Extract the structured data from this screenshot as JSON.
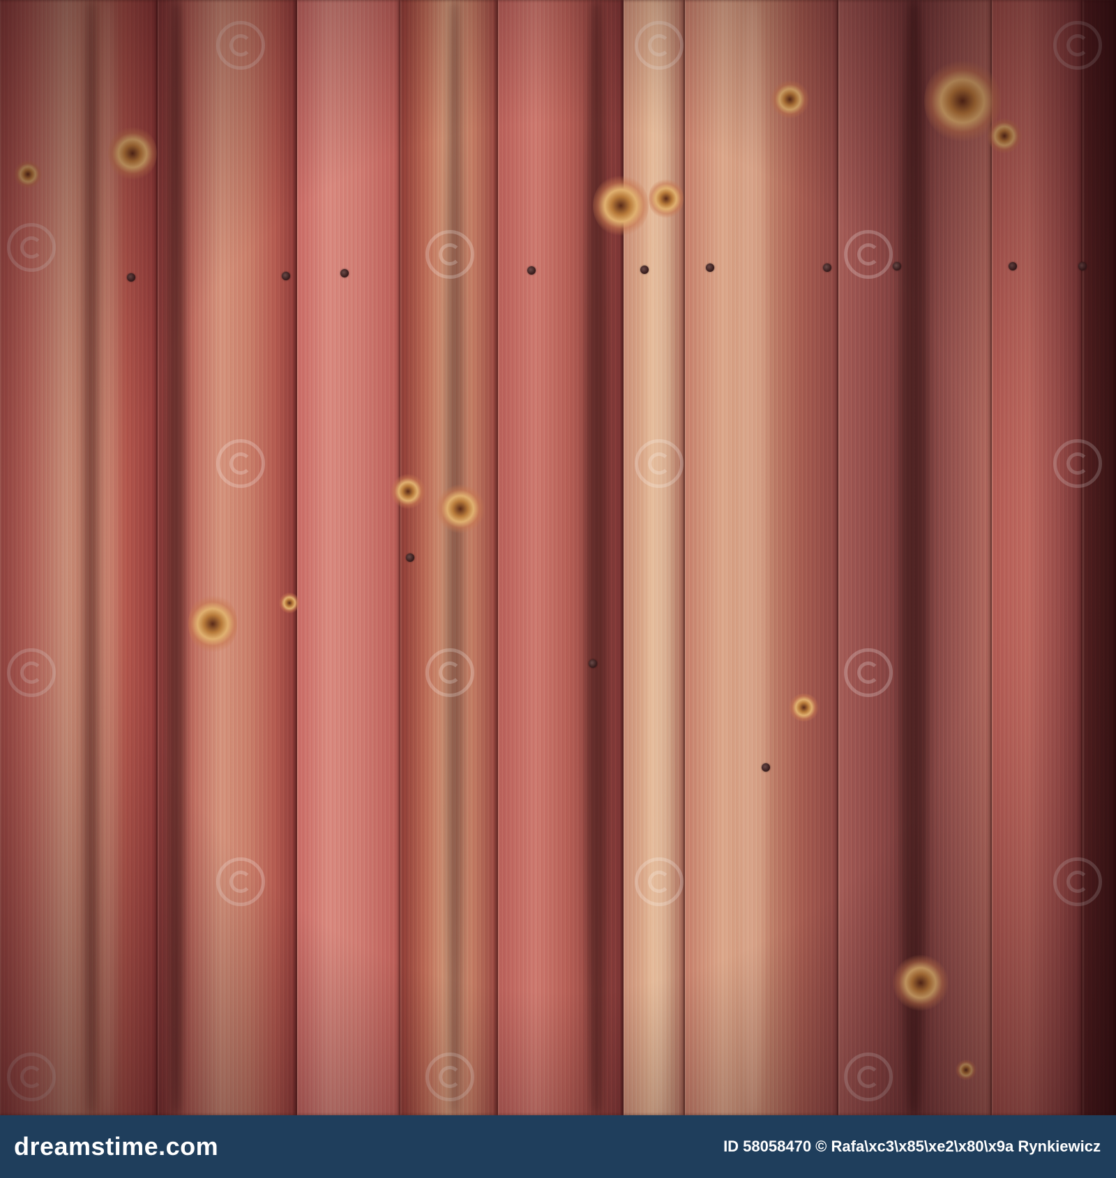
{
  "image": {
    "subject": "wood-planks",
    "palette": {
      "plank_base": "#b5574e",
      "plank_light": "#d9938a",
      "plank_dark": "#6b2a2a",
      "knot": "#d9a060",
      "footer_bg": "#1f3e5c"
    }
  },
  "footer": {
    "logo": "dreamstime.com",
    "credit": "ID 58058470 © Rafa\\xc3\\x85\\xe2\\x80\\x9a Rynkiewicz"
  }
}
